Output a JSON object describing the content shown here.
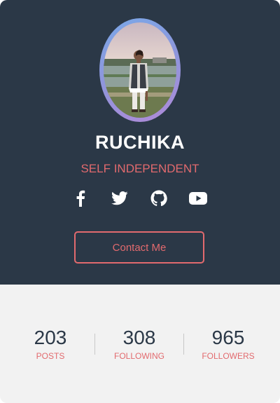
{
  "profile": {
    "name": "RUCHIKA",
    "tagline": "SELF INDEPENDENT",
    "photo": "profile-photo"
  },
  "socials": [
    {
      "icon": "facebook-icon"
    },
    {
      "icon": "twitter-icon"
    },
    {
      "icon": "github-icon"
    },
    {
      "icon": "youtube-icon"
    }
  ],
  "contact_button": {
    "label": "Contact Me"
  },
  "stats": [
    {
      "value": "203",
      "label": "POSTS"
    },
    {
      "value": "308",
      "label": "FOLLOWING"
    },
    {
      "value": "965",
      "label": "FOLLOWERS"
    }
  ],
  "colors": {
    "header_bg": "#2b3847",
    "accent": "#e26a6e",
    "stats_bg": "#f2f2f2",
    "text_light": "#ffffff"
  }
}
